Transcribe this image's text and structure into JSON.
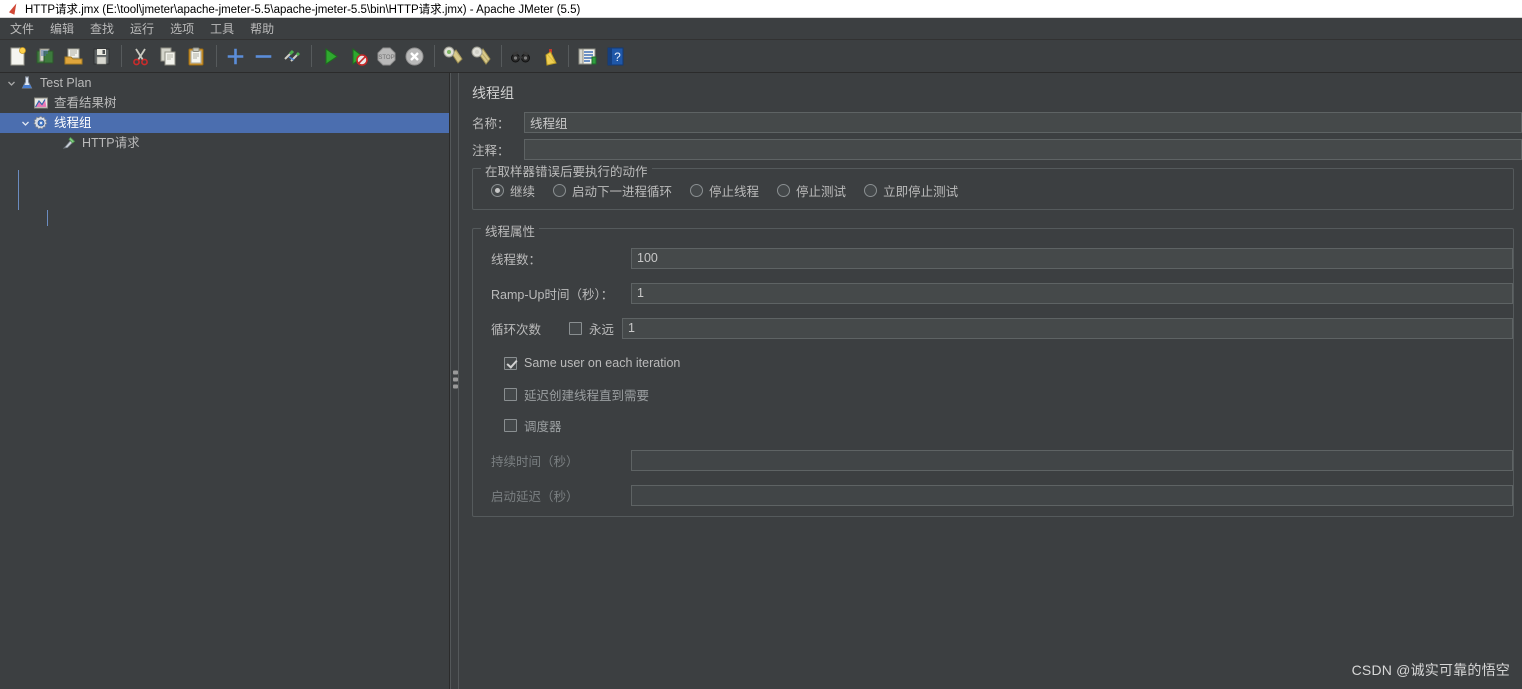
{
  "window": {
    "title": "HTTP请求.jmx (E:\\tool\\jmeter\\apache-jmeter-5.5\\apache-jmeter-5.5\\bin\\HTTP请求.jmx) - Apache JMeter (5.5)",
    "app_icon": "jmeter-flask-icon"
  },
  "menubar": {
    "items": [
      {
        "label": "文件"
      },
      {
        "label": "编辑"
      },
      {
        "label": "查找"
      },
      {
        "label": "运行"
      },
      {
        "label": "选项"
      },
      {
        "label": "工具"
      },
      {
        "label": "帮助"
      }
    ]
  },
  "toolbar": {
    "groups": [
      {
        "buttons": [
          {
            "name": "new-icon",
            "tooltip": "新建"
          },
          {
            "name": "templates-icon",
            "tooltip": "模板"
          },
          {
            "name": "open-icon",
            "tooltip": "打开"
          },
          {
            "name": "save-icon",
            "tooltip": "保存"
          }
        ]
      },
      {
        "buttons": [
          {
            "name": "cut-icon",
            "tooltip": "剪切"
          },
          {
            "name": "copy-icon",
            "tooltip": "复制"
          },
          {
            "name": "paste-icon",
            "tooltip": "粘贴"
          }
        ]
      },
      {
        "buttons": [
          {
            "name": "expand-all-icon",
            "tooltip": "展开全部"
          },
          {
            "name": "collapse-all-icon",
            "tooltip": "折叠全部"
          },
          {
            "name": "toggle-icon",
            "tooltip": "启用/禁用"
          }
        ]
      },
      {
        "buttons": [
          {
            "name": "start-icon",
            "tooltip": "启动"
          },
          {
            "name": "start-no-pause-icon",
            "tooltip": "无间隔启动"
          },
          {
            "name": "stop-icon",
            "tooltip": "停止"
          },
          {
            "name": "shutdown-icon",
            "tooltip": "关闭"
          }
        ]
      },
      {
        "buttons": [
          {
            "name": "clear-icon",
            "tooltip": "清除"
          },
          {
            "name": "clear-all-icon",
            "tooltip": "清除全部"
          }
        ]
      },
      {
        "buttons": [
          {
            "name": "search-icon",
            "tooltip": "查找"
          },
          {
            "name": "reset-search-icon",
            "tooltip": "重置查找"
          }
        ]
      },
      {
        "buttons": [
          {
            "name": "function-helper-icon",
            "tooltip": "函数助手对话框"
          },
          {
            "name": "help-icon",
            "tooltip": "帮助"
          }
        ]
      }
    ]
  },
  "tree": {
    "nodes": [
      {
        "label": "Test Plan",
        "icon": "test-plan-icon",
        "depth": 0,
        "twisty": "expanded",
        "selected": false
      },
      {
        "label": "查看结果树",
        "icon": "view-results-icon",
        "depth": 1,
        "twisty": "none",
        "selected": false
      },
      {
        "label": "线程组",
        "icon": "thread-group-icon",
        "depth": 1,
        "twisty": "expanded",
        "selected": true
      },
      {
        "label": "HTTP请求",
        "icon": "http-request-icon",
        "depth": 2,
        "twisty": "none",
        "selected": false
      }
    ]
  },
  "panel": {
    "title": "线程组",
    "name_label": "名称：",
    "name_value": "线程组",
    "comment_label": "注释：",
    "comment_value": "",
    "error_action": {
      "legend": "在取样器错误后要执行的动作",
      "options": [
        {
          "label": "继续",
          "checked": true
        },
        {
          "label": "启动下一进程循环",
          "checked": false
        },
        {
          "label": "停止线程",
          "checked": false
        },
        {
          "label": "停止测试",
          "checked": false
        },
        {
          "label": "立即停止测试",
          "checked": false
        }
      ]
    },
    "thread_properties": {
      "legend": "线程属性",
      "num_threads_label": "线程数：",
      "num_threads_value": "100",
      "ramp_up_label": "Ramp-Up时间（秒）：",
      "ramp_up_value": "1",
      "loop_label": "循环次数",
      "loop_forever_label": "永远",
      "loop_forever_checked": false,
      "loop_count_value": "1",
      "same_user_label": "Same user on each iteration",
      "same_user_checked": true,
      "delayed_start_label": "延迟创建线程直到需要",
      "delayed_start_checked": false,
      "scheduler_label": "调度器",
      "scheduler_checked": false,
      "duration_label": "持续时间（秒）",
      "duration_value": "",
      "startup_delay_label": "启动延迟（秒）",
      "startup_delay_value": ""
    }
  },
  "watermark": {
    "text": "CSDN @诚实可靠的悟空"
  },
  "colors": {
    "window_bg": "#3c3f41",
    "selection": "#4b6eaf",
    "text": "#bbbbbb",
    "field_bg": "#45494a",
    "field_border": "#5e6364",
    "titlebar_bg": "#ffffff"
  }
}
